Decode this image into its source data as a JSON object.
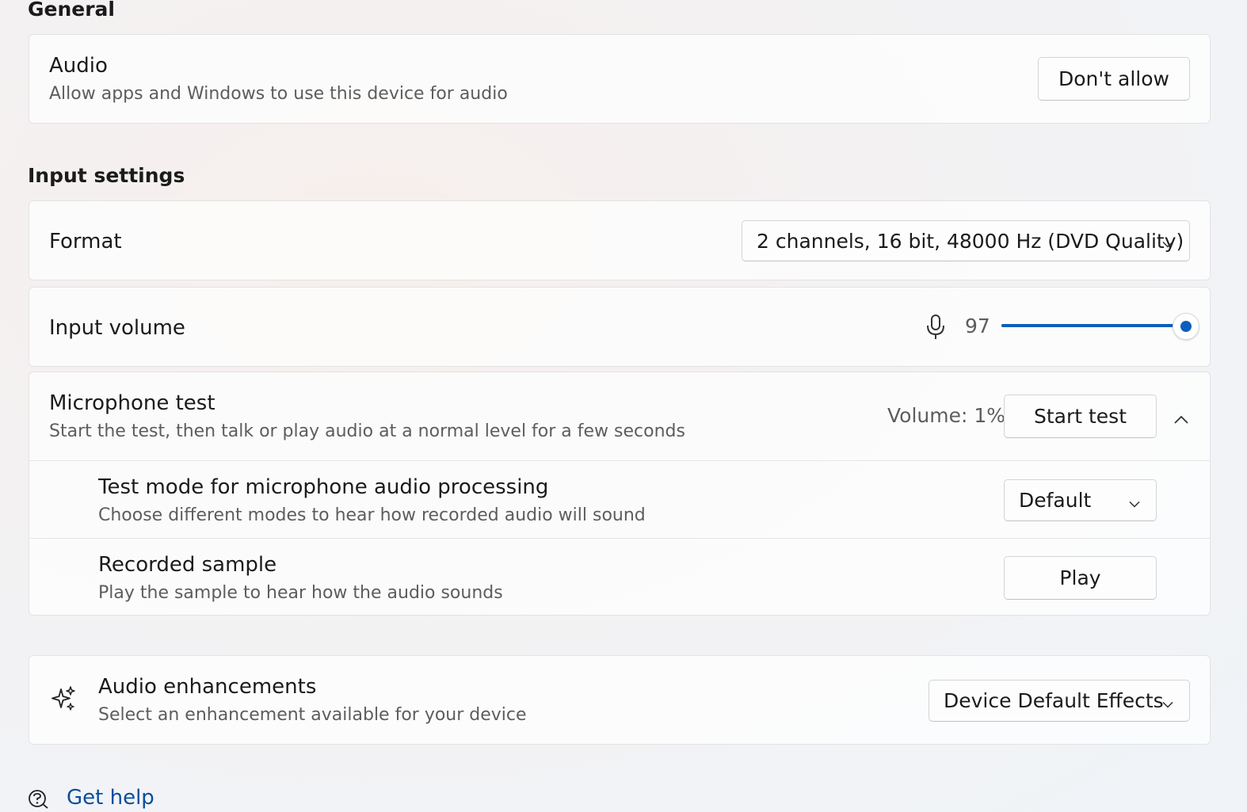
{
  "general": {
    "heading": "General",
    "audio": {
      "title": "Audio",
      "description": "Allow apps and Windows to use this device for audio",
      "button_label": "Don't allow"
    }
  },
  "input_settings": {
    "heading": "Input settings",
    "format": {
      "title": "Format",
      "selected": "2 channels, 16 bit, 48000 Hz (DVD Quality)"
    },
    "input_volume": {
      "title": "Input volume",
      "value": "97",
      "level": 97,
      "icon": "microphone-icon"
    },
    "microphone_test": {
      "title": "Microphone test",
      "description": "Start the test, then talk or play audio at a normal level for a few seconds",
      "volume_text": "Volume: 1%",
      "button_label": "Start test",
      "expanded": true,
      "test_mode": {
        "title": "Test mode for microphone audio processing",
        "description": "Choose different modes to hear how recorded audio will sound",
        "selected": "Default"
      },
      "recorded_sample": {
        "title": "Recorded sample",
        "description": "Play the sample to hear how the audio sounds",
        "button_label": "Play"
      }
    }
  },
  "audio_enhancements": {
    "title": "Audio enhancements",
    "description": "Select an enhancement available for your device",
    "selected": "Device Default Effects",
    "icon": "sparkles-icon"
  },
  "help": {
    "link_label": "Get help",
    "icon": "help-chat-icon"
  },
  "colors": {
    "accent": "#0a5fbd",
    "link": "#0a4d9c"
  }
}
